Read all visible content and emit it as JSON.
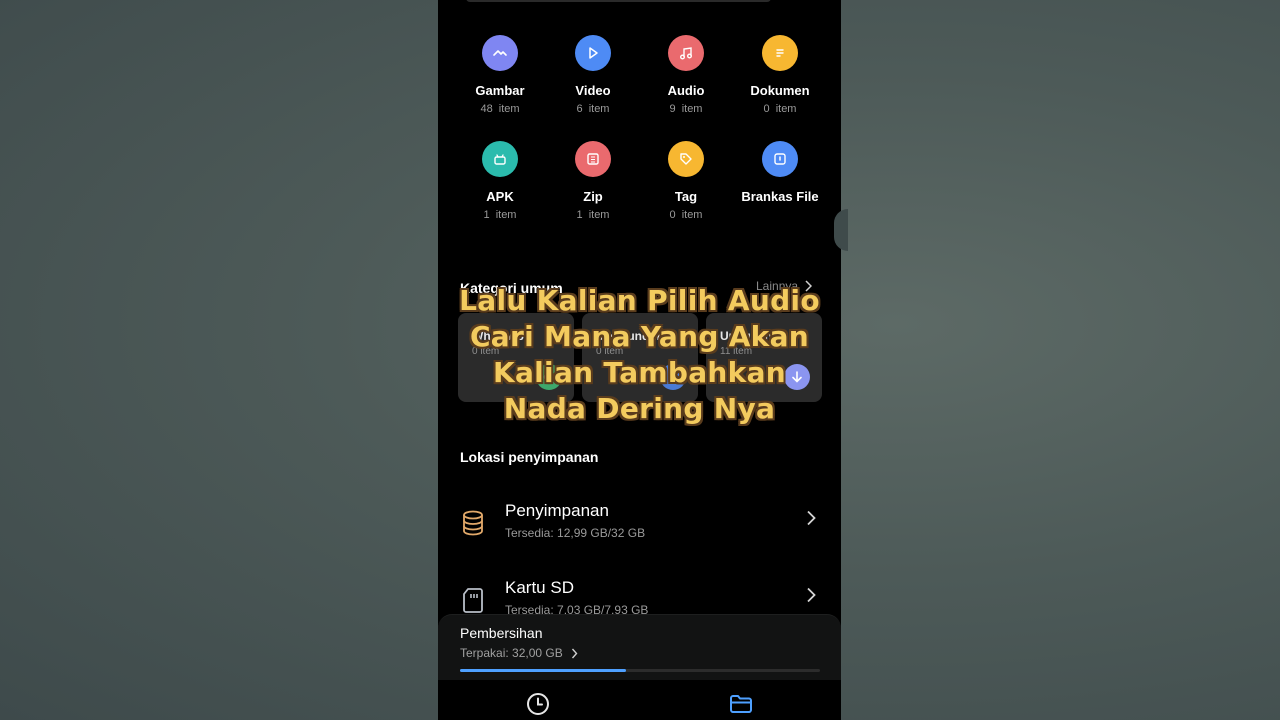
{
  "categories": [
    {
      "name": "Gambar",
      "count": "48 item",
      "color": "#7f86f2",
      "icon": "image-icon"
    },
    {
      "name": "Video",
      "count": "6 item",
      "color": "#4e8bf5",
      "icon": "play-icon"
    },
    {
      "name": "Audio",
      "count": "9 item",
      "color": "#ea6a6e",
      "icon": "music-icon"
    },
    {
      "name": "Dokumen",
      "count": "0 item",
      "color": "#f7b731",
      "icon": "document-icon"
    },
    {
      "name": "APK",
      "count": "1 item",
      "color": "#2bbbad",
      "icon": "android-icon"
    },
    {
      "name": "Zip",
      "count": "1 item",
      "color": "#ea6a6e",
      "icon": "archive-icon"
    },
    {
      "name": "Tag",
      "count": "0 item",
      "color": "#f7b731",
      "icon": "tag-icon"
    },
    {
      "name": "Brankas File",
      "count": "",
      "color": "#4e8bf5",
      "icon": "vault-icon"
    }
  ],
  "common": {
    "title": "Kategori umum",
    "more": "Lainnya",
    "cards": [
      {
        "title": "WhatsApp",
        "count": "0 item"
      },
      {
        "title": "Mengunduh",
        "count": "0 item"
      },
      {
        "title": "Unduhan",
        "count": "11 item"
      }
    ]
  },
  "locations": {
    "title": "Lokasi penyimpanan",
    "items": [
      {
        "name": "Penyimpanan",
        "detail": "Tersedia: 12,99 GB/32 GB"
      },
      {
        "name": "Kartu SD",
        "detail": "Tersedia: 7,03 GB/7,93 GB"
      }
    ]
  },
  "cleanup": {
    "title": "Pembersihan",
    "used": "Terpakai: 32,00 GB",
    "progress_fraction": 0.46
  },
  "overlay": {
    "lines": [
      "Lalu Kalian Pilih Audio",
      "Cari Mana Yang Akan",
      "Kalian Tambahkan",
      "Nada Dering Nya"
    ]
  },
  "colors": {
    "accent": "#4ea0ff",
    "overlay_text": "#f3cb5e"
  }
}
